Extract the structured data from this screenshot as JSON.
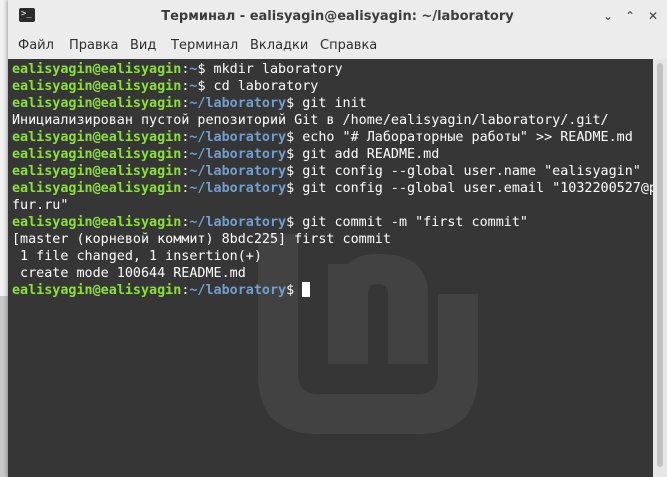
{
  "window": {
    "title": "Терминал - ealisyagin@ealisyagin: ~/laboratory",
    "buttons": {
      "minimize": "⌄",
      "maximize": "⌃",
      "close": "✕"
    }
  },
  "menu": [
    "Файл",
    "Правка",
    "Вид",
    "Терминал",
    "Вкладки",
    "Справка"
  ],
  "terminal": {
    "prompt_user": "ealisyagin@ealisyagin",
    "prompt_sep": ":",
    "lines": [
      {
        "type": "prompt",
        "path": "~",
        "cmd": "$ mkdir laboratory"
      },
      {
        "type": "prompt",
        "path": "~",
        "cmd": "$ cd laboratory"
      },
      {
        "type": "prompt",
        "path": "~/laboratory",
        "cmd": "$ git init"
      },
      {
        "type": "output",
        "text": "Инициализирован пустой репозиторий Git в /home/ealisyagin/laboratory/.git/"
      },
      {
        "type": "prompt",
        "path": "~/laboratory",
        "cmd": "$ echo \"# Лабораторные работы\" >> README.md"
      },
      {
        "type": "prompt",
        "path": "~/laboratory",
        "cmd": "$ git add README.md"
      },
      {
        "type": "prompt",
        "path": "~/laboratory",
        "cmd": "$ git config --global user.name \"ealisyagin\""
      },
      {
        "type": "prompt",
        "path": "~/laboratory",
        "cmd": "$ git config --global user.email \"1032200527@p"
      },
      {
        "type": "output",
        "text": "fur.ru\""
      },
      {
        "type": "prompt",
        "path": "~/laboratory",
        "cmd": "$ git commit -m \"first commit\""
      },
      {
        "type": "output",
        "text": "[master (корневой коммит) 8bdc225] first commit"
      },
      {
        "type": "output",
        "text": " 1 file changed, 1 insertion(+)"
      },
      {
        "type": "output",
        "text": " create mode 100644 README.md"
      },
      {
        "type": "prompt",
        "path": "~/laboratory",
        "cmd": "$ ",
        "cursor": true
      }
    ]
  },
  "colors": {
    "user": "#8ae234",
    "path": "#729fcf",
    "background": "#363636"
  }
}
